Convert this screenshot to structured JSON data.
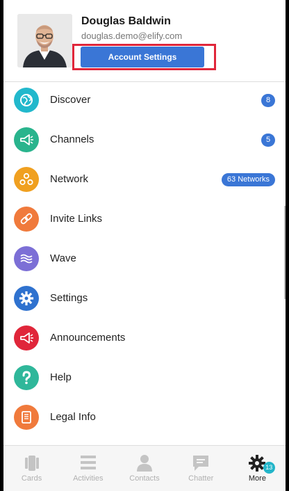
{
  "profile": {
    "name": "Douglas Baldwin",
    "email": "douglas.demo@elify.com",
    "account_settings_label": "Account Settings"
  },
  "menu": {
    "items": [
      {
        "label": "Discover",
        "icon": "globe-icon",
        "color": "#22b8cc",
        "badge": "8"
      },
      {
        "label": "Channels",
        "icon": "megaphone-icon",
        "color": "#29b48d",
        "badge": "5"
      },
      {
        "label": "Network",
        "icon": "network-icon",
        "color": "#f0a020",
        "badge": "63 Networks"
      },
      {
        "label": "Invite Links",
        "icon": "link-icon",
        "color": "#f07a3c",
        "badge": ""
      },
      {
        "label": "Wave",
        "icon": "wave-icon",
        "color": "#7c6fd6",
        "badge": ""
      },
      {
        "label": "Settings",
        "icon": "gear-icon",
        "color": "#2f72cf",
        "badge": ""
      },
      {
        "label": "Announcements",
        "icon": "bullhorn-icon",
        "color": "#e0263a",
        "badge": ""
      },
      {
        "label": "Help",
        "icon": "question-icon",
        "color": "#2fb79a",
        "badge": ""
      },
      {
        "label": "Legal Info",
        "icon": "document-icon",
        "color": "#f07a3c",
        "badge": ""
      }
    ]
  },
  "tabbar": {
    "tabs": [
      {
        "label": "Cards",
        "icon": "cards-icon",
        "active": false
      },
      {
        "label": "Activities",
        "icon": "activities-icon",
        "active": false
      },
      {
        "label": "Contacts",
        "icon": "contacts-icon",
        "active": false
      },
      {
        "label": "Chatter",
        "icon": "chatter-icon",
        "active": false
      },
      {
        "label": "More",
        "icon": "more-gear-icon",
        "active": true,
        "badge": "13"
      }
    ]
  },
  "colors": {
    "accent": "#3a76d6",
    "highlight": "#e0263a",
    "tab_active": "#23b5c9"
  }
}
